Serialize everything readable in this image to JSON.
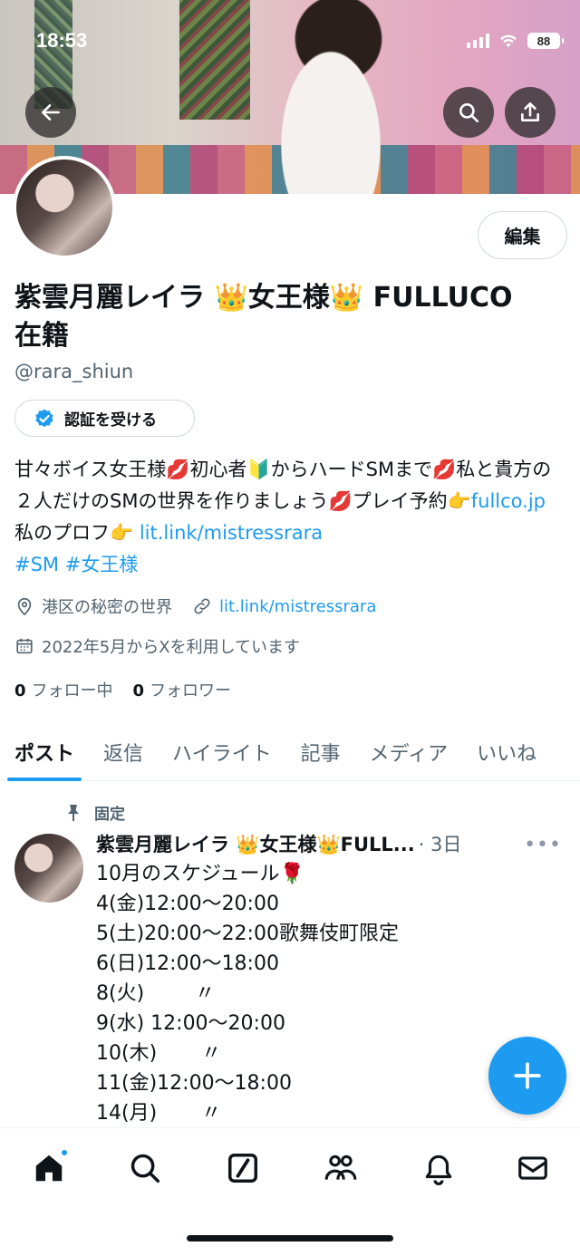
{
  "status_bar": {
    "time": "18:53",
    "battery": "88"
  },
  "profile": {
    "name": "紫雲月麗レイラ 👑女王様👑 FULLUCO 在籍",
    "handle": "@rara_shiun",
    "edit_label": "編集",
    "verify_label": "認証を受ける",
    "bio_text": "甘々ボイス女王様💋初心者🔰からハードSMまで💋私と貴方の２人だけのSMの世界を作りましょう💋プレイ予約👉",
    "bio_link1": "fullco.jp",
    "bio_mid": " 私のプロフ👉 ",
    "bio_link2": "lit.link/mistressrara",
    "bio_tags": "#SM #女王様",
    "location": "港区の秘密の世界",
    "website": "lit.link/mistressrara",
    "joined": "2022年5月からXを利用しています",
    "following_count": "0",
    "following_label": "フォロー中",
    "followers_count": "0",
    "followers_label": "フォロワー"
  },
  "tabs": [
    "ポスト",
    "返信",
    "ハイライト",
    "記事",
    "メディア",
    "いいね"
  ],
  "pinned_label": "固定",
  "post": {
    "author": "紫雲月麗レイラ 👑女王様👑FULL...",
    "time": "· 3日",
    "body": "10月のスケジュール🌹\n4(金)12:00〜20:00\n5(土)20:00〜22:00歌舞伎町限定\n6(日)12:00〜18:00\n8(火)        〃\n9(水) 12:00〜20:00\n10(木)       〃\n11(金)12:00〜18:00\n14(月)       〃"
  },
  "icons": {
    "back": "arrow-left-icon",
    "search": "search-icon",
    "share": "share-icon",
    "verified": "verified-badge-icon",
    "location": "location-pin-icon",
    "link": "link-icon",
    "calendar": "calendar-icon",
    "pin": "pin-icon",
    "more": "more-icon",
    "compose": "plus-icon",
    "nav": [
      "home-icon",
      "search-icon",
      "grok-icon",
      "communities-icon",
      "notifications-icon",
      "messages-icon"
    ]
  },
  "colors": {
    "accent": "#1d9bf0",
    "text": "#0f1419",
    "secondary": "#536471"
  }
}
